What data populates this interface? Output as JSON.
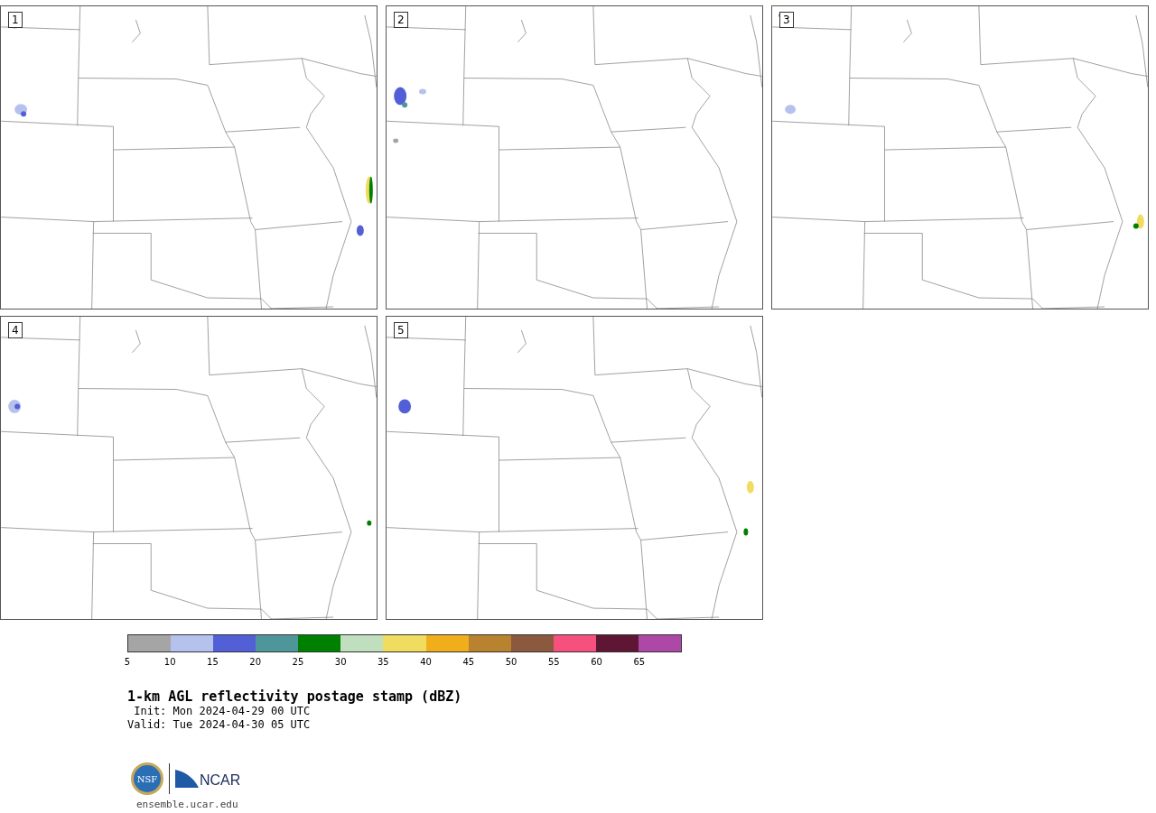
{
  "panels": [
    {
      "label": "1"
    },
    {
      "label": "2"
    },
    {
      "label": "3"
    },
    {
      "label": "4"
    },
    {
      "label": "5"
    }
  ],
  "colorbar": {
    "bins": [
      {
        "color": "#a5a5a5"
      },
      {
        "color": "#b6c2ee"
      },
      {
        "color": "#525fd6"
      },
      {
        "color": "#4f969a"
      },
      {
        "color": "#008000"
      },
      {
        "color": "#bfdfbf"
      },
      {
        "color": "#f0dc5f"
      },
      {
        "color": "#f0ae1a"
      },
      {
        "color": "#b8822f"
      },
      {
        "color": "#8a593e"
      },
      {
        "color": "#f5507e"
      },
      {
        "color": "#5f1634"
      },
      {
        "color": "#ad48a6"
      }
    ],
    "ticks": [
      "5",
      "10",
      "15",
      "20",
      "25",
      "30",
      "35",
      "40",
      "45",
      "50",
      "55",
      "60",
      "65"
    ]
  },
  "title": "1-km AGL reflectivity postage stamp (dBZ)",
  "init": " Init: Mon 2024-04-29 00 UTC",
  "valid": "Valid: Tue 2024-04-30 05 UTC",
  "logo": {
    "nsf": "NSF",
    "ncar": "NCAR"
  },
  "url": "ensemble.ucar.edu"
}
